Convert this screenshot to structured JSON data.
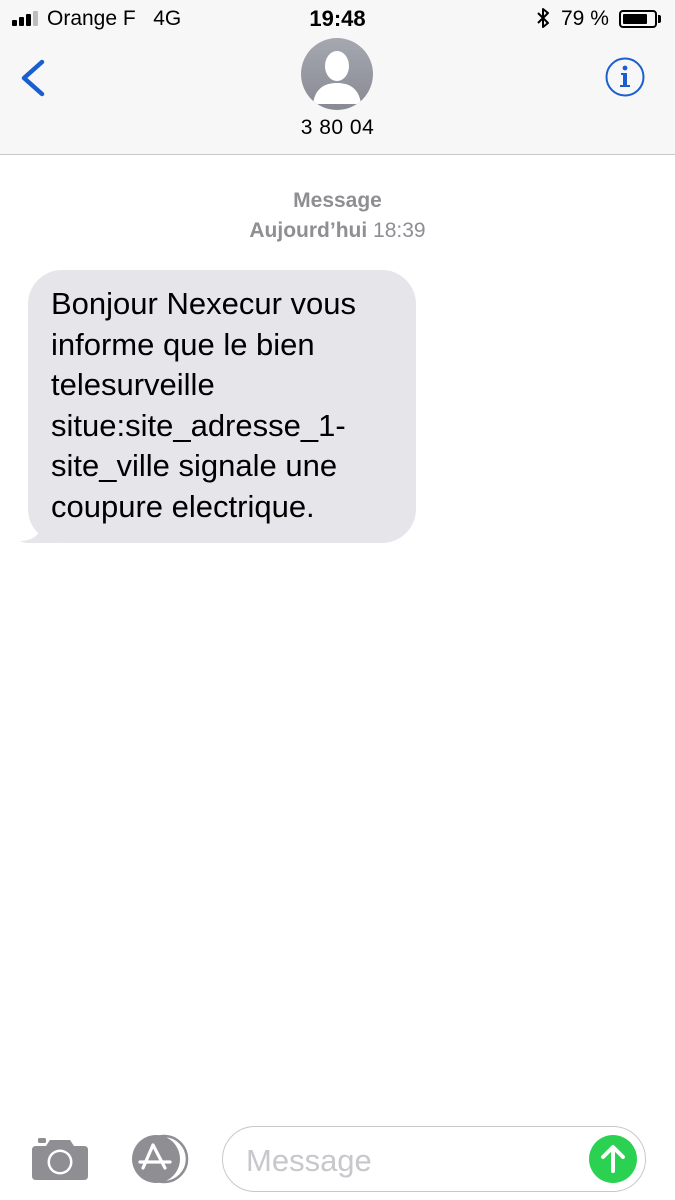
{
  "status_bar": {
    "carrier": "Orange F   4G",
    "time": "19:48",
    "battery_percent_text": "79 %",
    "battery_level": 0.79,
    "signal_bars_filled": 3,
    "signal_bars_total": 4
  },
  "header": {
    "contact_name": "3 80 04",
    "accent_color": "#1a5fd0"
  },
  "thread": {
    "label": "Message",
    "date_day": "Aujourd’hui",
    "date_time": "18:39"
  },
  "messages": [
    {
      "direction": "incoming",
      "lines": [
        "Bonjour Nexecur vous",
        "informe que le bien",
        "telesurveille",
        "situe:site_adresse_1-",
        "site_ville signale une",
        "coupure electrique."
      ]
    }
  ],
  "composer": {
    "placeholder": "Message",
    "send_color": "#2bd150"
  }
}
